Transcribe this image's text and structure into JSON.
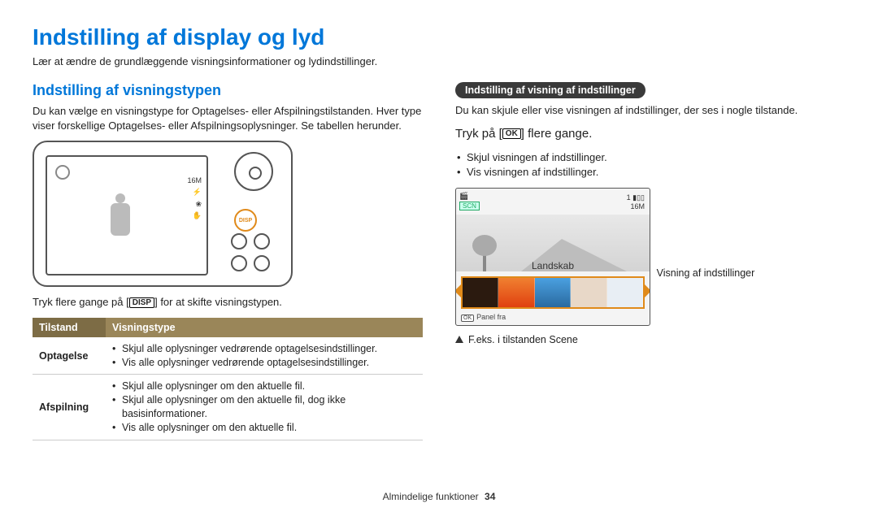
{
  "page": {
    "title": "Indstilling af display og lyd",
    "intro": "Lær at ændre de grundlæggende visningsinformationer og lydindstillinger."
  },
  "left": {
    "heading": "Indstilling af visningstypen",
    "desc": "Du kan vælge en visningstype for Optagelses- eller Afspilningstilstanden. Hver type viser forskellige Optagelses- eller Afspilningsoplysninger. Se tabellen herunder.",
    "cam_icons": {
      "a": "16M",
      "b": "⚡",
      "c": "❀",
      "d": "✋"
    },
    "cam_disp_label": "DISP",
    "caption_pre": "Tryk flere gange på [",
    "caption_key": "DISP",
    "caption_post": "] for at skifte visningstypen.",
    "th1": "Tilstand",
    "th2": "Visningstype",
    "row1_mode": "Optagelse",
    "row1_items": [
      "Skjul alle oplysninger vedrørende optagelsesindstillinger.",
      "Vis alle oplysninger vedrørende optagelsesindstillinger."
    ],
    "row2_mode": "Afspilning",
    "row2_items": [
      "Skjul alle oplysninger om den aktuelle fil.",
      "Skjul alle oplysninger om den aktuelle fil, dog ikke basisinformationer.",
      "Vis alle oplysninger om den aktuelle fil."
    ]
  },
  "right": {
    "pill": "Indstilling af visning af indstillinger",
    "desc": "Du kan skjule eller vise visningen af indstillinger, der ses i nogle tilstande.",
    "press_pre": "Tryk på [",
    "press_key": "OK",
    "press_post": "] flere gange.",
    "bullets": [
      "Skjul visningen af indstillinger.",
      "Vis visningen af indstillinger."
    ],
    "scene_scn": "SCN",
    "scene_tr1": "1",
    "scene_tr2": "16M",
    "scene_label": "Landskab",
    "scene_panel_key": "OK",
    "scene_panel_text": "Panel fra",
    "callout": "Visning af indstillinger",
    "footnote": "F.eks. i tilstanden Scene"
  },
  "footer": {
    "section": "Almindelige funktioner",
    "page": "34"
  }
}
